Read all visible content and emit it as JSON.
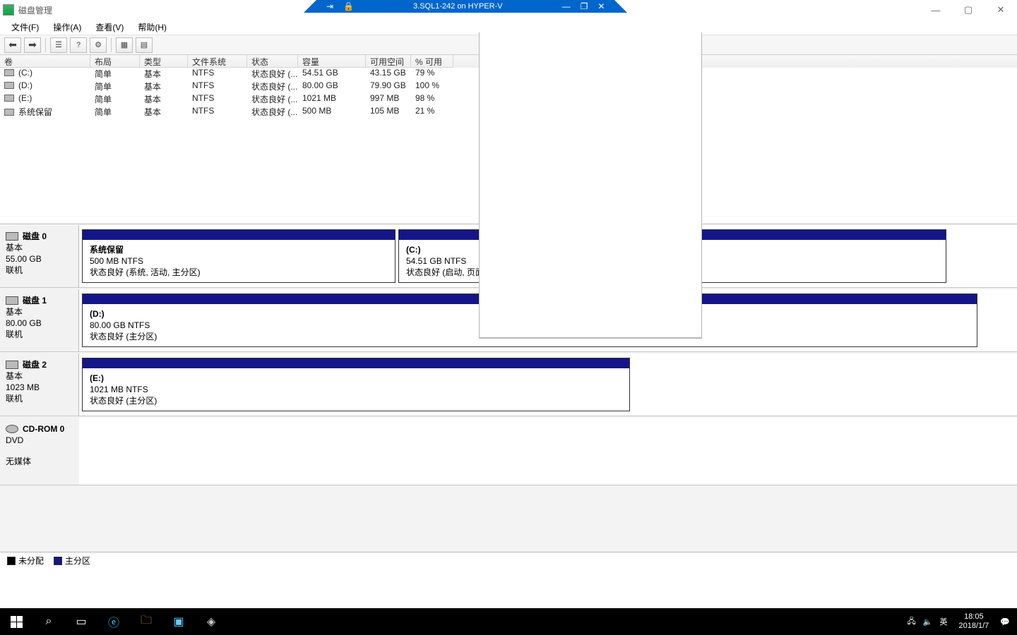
{
  "title_bar": {
    "app_name": "磁盘管理"
  },
  "os_win_btns": {
    "min": "—",
    "max": "▢",
    "close": "✕"
  },
  "hv_bar": {
    "pin": "⇥",
    "lock": "🔒",
    "title": "3.SQL1-242 on HYPER-V",
    "min": "—",
    "max": "❐",
    "close": "✕"
  },
  "menu": {
    "file": "文件(F)",
    "action": "操作(A)",
    "view": "查看(V)",
    "help": "帮助(H)"
  },
  "toolbar_icons": {
    "back": "⬅",
    "fwd": "➡",
    "refresh": "⟳",
    "list": "☰",
    "props": "⚙",
    "help": "?",
    "grid": "▦",
    "detail": "▤"
  },
  "vol_head": {
    "vol": "卷",
    "layout": "布局",
    "type": "类型",
    "fs": "文件系统",
    "status": "状态",
    "capacity": "容量",
    "free": "可用空间",
    "pct": "% 可用"
  },
  "volumes": [
    {
      "name": "(C:)",
      "layout": "简单",
      "type": "基本",
      "fs": "NTFS",
      "status": "状态良好 (...",
      "cap": "54.51 GB",
      "free": "43.15 GB",
      "pct": "79 %"
    },
    {
      "name": "(D:)",
      "layout": "简单",
      "type": "基本",
      "fs": "NTFS",
      "status": "状态良好 (...",
      "cap": "80.00 GB",
      "free": "79.90 GB",
      "pct": "100 %"
    },
    {
      "name": "(E:)",
      "layout": "简单",
      "type": "基本",
      "fs": "NTFS",
      "status": "状态良好 (...",
      "cap": "1021 MB",
      "free": "997 MB",
      "pct": "98 %"
    },
    {
      "name": "系统保留",
      "layout": "简单",
      "type": "基本",
      "fs": "NTFS",
      "status": "状态良好 (...",
      "cap": "500 MB",
      "free": "105 MB",
      "pct": "21 %"
    }
  ],
  "disks": {
    "d0": {
      "name": "磁盘 0",
      "type": "基本",
      "size": "55.00 GB",
      "state": "联机",
      "p0": {
        "title": "系统保留",
        "line2": "500 MB NTFS",
        "line3": "状态良好 (系统, 活动, 主分区)"
      },
      "p1": {
        "title": "(C:)",
        "line2": "54.51 GB NTFS",
        "line3": "状态良好 (启动, 页面文件, 故障转储, 主分区)"
      }
    },
    "d1": {
      "name": "磁盘 1",
      "type": "基本",
      "size": "80.00 GB",
      "state": "联机",
      "p0": {
        "title": "(D:)",
        "line2": "80.00 GB NTFS",
        "line3": "状态良好 (主分区)"
      }
    },
    "d2": {
      "name": "磁盘 2",
      "type": "基本",
      "size": "1023 MB",
      "state": "联机",
      "p0": {
        "title": "(E:)",
        "line2": "1021 MB NTFS",
        "line3": "状态良好 (主分区)"
      }
    },
    "cd": {
      "name": "CD-ROM 0",
      "type": "DVD",
      "state": "无媒体"
    }
  },
  "legend": {
    "unalloc": "未分配",
    "primary": "主分区"
  },
  "taskbar": {
    "ime": "英",
    "time": "18:05",
    "date": "2018/1/7"
  }
}
